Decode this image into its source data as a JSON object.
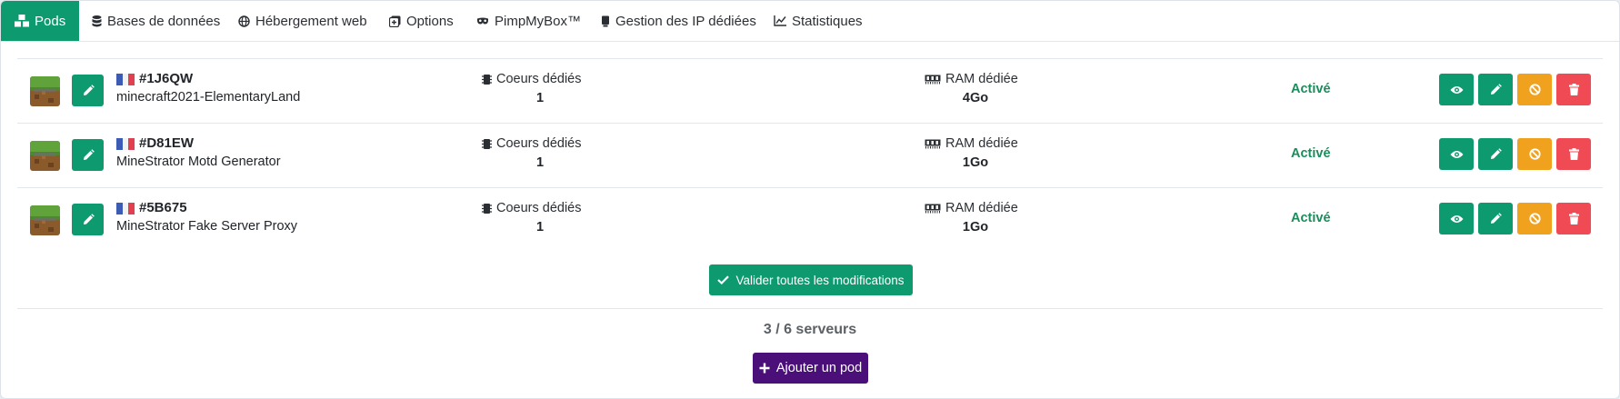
{
  "tabs": [
    {
      "label": "Pods",
      "icon": "cubes-icon",
      "active": true
    },
    {
      "label": "Bases de données",
      "icon": "database-icon"
    },
    {
      "label": "Hébergement web",
      "icon": "globe-icon"
    },
    {
      "label": "Options",
      "icon": "plus-square-icon"
    },
    {
      "label": "PimpMyBox™",
      "icon": "mask-icon"
    },
    {
      "label": "Gestion des IP dédiées",
      "icon": "server-icon"
    },
    {
      "label": "Statistiques",
      "icon": "chart-line-icon"
    }
  ],
  "pods": [
    {
      "id": "#1J6QW",
      "name": "minecraft2021-ElementaryLand",
      "cores_label": "Coeurs dédiés",
      "cores": "1",
      "ram_label": "RAM dédiée",
      "ram": "4Go",
      "status": "Activé",
      "country_flag": "france-flag"
    },
    {
      "id": "#D81EW",
      "name": "MineStrator Motd Generator",
      "cores_label": "Coeurs dédiés",
      "cores": "1",
      "ram_label": "RAM dédiée",
      "ram": "1Go",
      "status": "Activé",
      "country_flag": "france-flag"
    },
    {
      "id": "#5B675",
      "name": "MineStrator Fake Server Proxy",
      "cores_label": "Coeurs dédiés",
      "cores": "1",
      "ram_label": "RAM dédiée",
      "ram": "1Go",
      "status": "Activé",
      "country_flag": "france-flag"
    }
  ],
  "actions": {
    "validate_label": "Valider toutes les modifications",
    "count_label": "3 / 6 serveurs",
    "add_label": "Ajouter un pod"
  },
  "colors": {
    "primary": "#0e9a6f",
    "warning": "#f0a21f",
    "danger": "#f04a55",
    "add_button": "#4b0f7a",
    "status_active": "#1c8c5c"
  }
}
